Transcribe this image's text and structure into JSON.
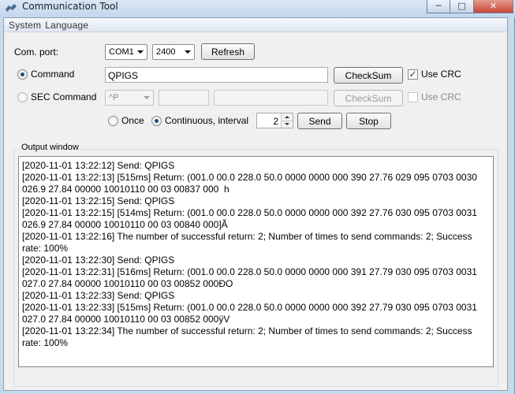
{
  "window": {
    "title": "Communication Tool",
    "controls": {
      "minimize": "─",
      "maximize": "□",
      "close": "✕"
    }
  },
  "menu": [
    "System",
    "Language"
  ],
  "com": {
    "label": "Com. port:",
    "port": "COM1",
    "baud": "2400",
    "refresh_label": "Refresh"
  },
  "command": {
    "label": "Command",
    "selected": true,
    "value": "QPIGS",
    "checksum_label": "CheckSum",
    "use_crc_label": "Use CRC",
    "use_crc_checked": true
  },
  "sec_command": {
    "label": "SEC Command",
    "selected": false,
    "prefix": "^P",
    "value1": "",
    "value2": "",
    "checksum_label": "CheckSum",
    "use_crc_label": "Use CRC",
    "use_crc_checked": false
  },
  "send_mode": {
    "once_label": "Once",
    "continuous_label": "Continuous, interval",
    "mode": "continuous",
    "interval": "2",
    "send_label": "Send",
    "stop_label": "Stop"
  },
  "output": {
    "label": "Output window",
    "lines": [
      "[2020-11-01 13:22:12] Send: QPIGS",
      "[2020-11-01 13:22:13] [515ms] Return: (001.0 00.0 228.0 50.0 0000 0000 000 390 27.76 029 095 0703 0030 026.9 27.84 00000 10010110 00 03 00837 000  h",
      "[2020-11-01 13:22:15] Send: QPIGS",
      "[2020-11-01 13:22:15] [514ms] Return: (001.0 00.0 228.0 50.0 0000 0000 000 392 27.76 030 095 0703 0031 026.9 27.84 00000 10010110 00 03 00840 000]Ã",
      "[2020-11-01 13:22:16] The number of successful return: 2; Number of times to send commands: 2; Success rate: 100%",
      "[2020-11-01 13:22:30] Send: QPIGS",
      "[2020-11-01 13:22:31] [516ms] Return: (001.0 00.0 228.0 50.0 0000 0000 000 391 27.79 030 095 0703 0031 027.0 27.84 00000 10010110 00 03 00852 000ÐO",
      "[2020-11-01 13:22:33] Send: QPIGS",
      "[2020-11-01 13:22:33] [515ms] Return: (001.0 00.0 228.0 50.0 0000 0000 000 392 27.79 030 095 0703 0031 027.0 27.84 00000 10010110 00 03 00852 000ÿV",
      "[2020-11-01 13:22:34] The number of successful return: 2; Number of times to send commands: 2; Success rate: 100%"
    ]
  }
}
